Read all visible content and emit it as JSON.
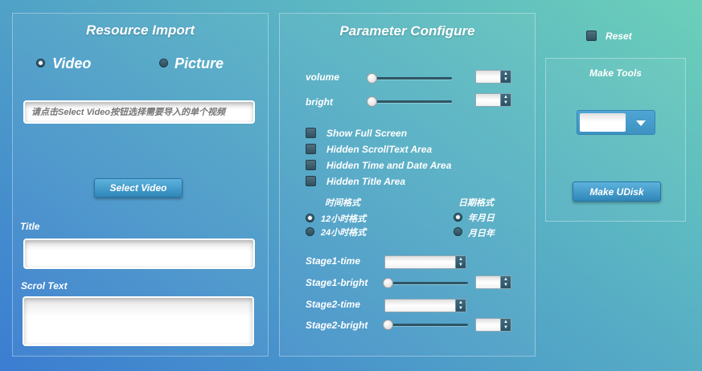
{
  "resource_import": {
    "title": "Resource Import",
    "radio_video": "Video",
    "radio_picture": "Picture",
    "path_placeholder": "请点击Select Video按钮选择需要导入的单个视频",
    "select_button": "Select Video",
    "title_label": "Title",
    "scroll_text_label": "Scrol Text"
  },
  "parameter_configure": {
    "title": "Parameter Configure",
    "volume_label": "volume",
    "bright_label": "bright",
    "checkboxes": [
      "Show Full Screen",
      "Hidden ScrollText Area",
      "Hidden Time and Date Area",
      "Hidden Title Area"
    ],
    "time_format_label": "时间格式",
    "time_12h": "12小时格式",
    "time_24h": "24小时格式",
    "date_format_label": "日期格式",
    "date_ymd": "年月日",
    "date_mdy": "月日年",
    "stage1_time": "Stage1-time",
    "stage1_bright": "Stage1-bright",
    "stage2_time": "Stage2-time",
    "stage2_bright": "Stage2-bright"
  },
  "reset_label": "Reset",
  "make_tools": {
    "title": "Make Tools",
    "make_button": "Make UDisk"
  }
}
